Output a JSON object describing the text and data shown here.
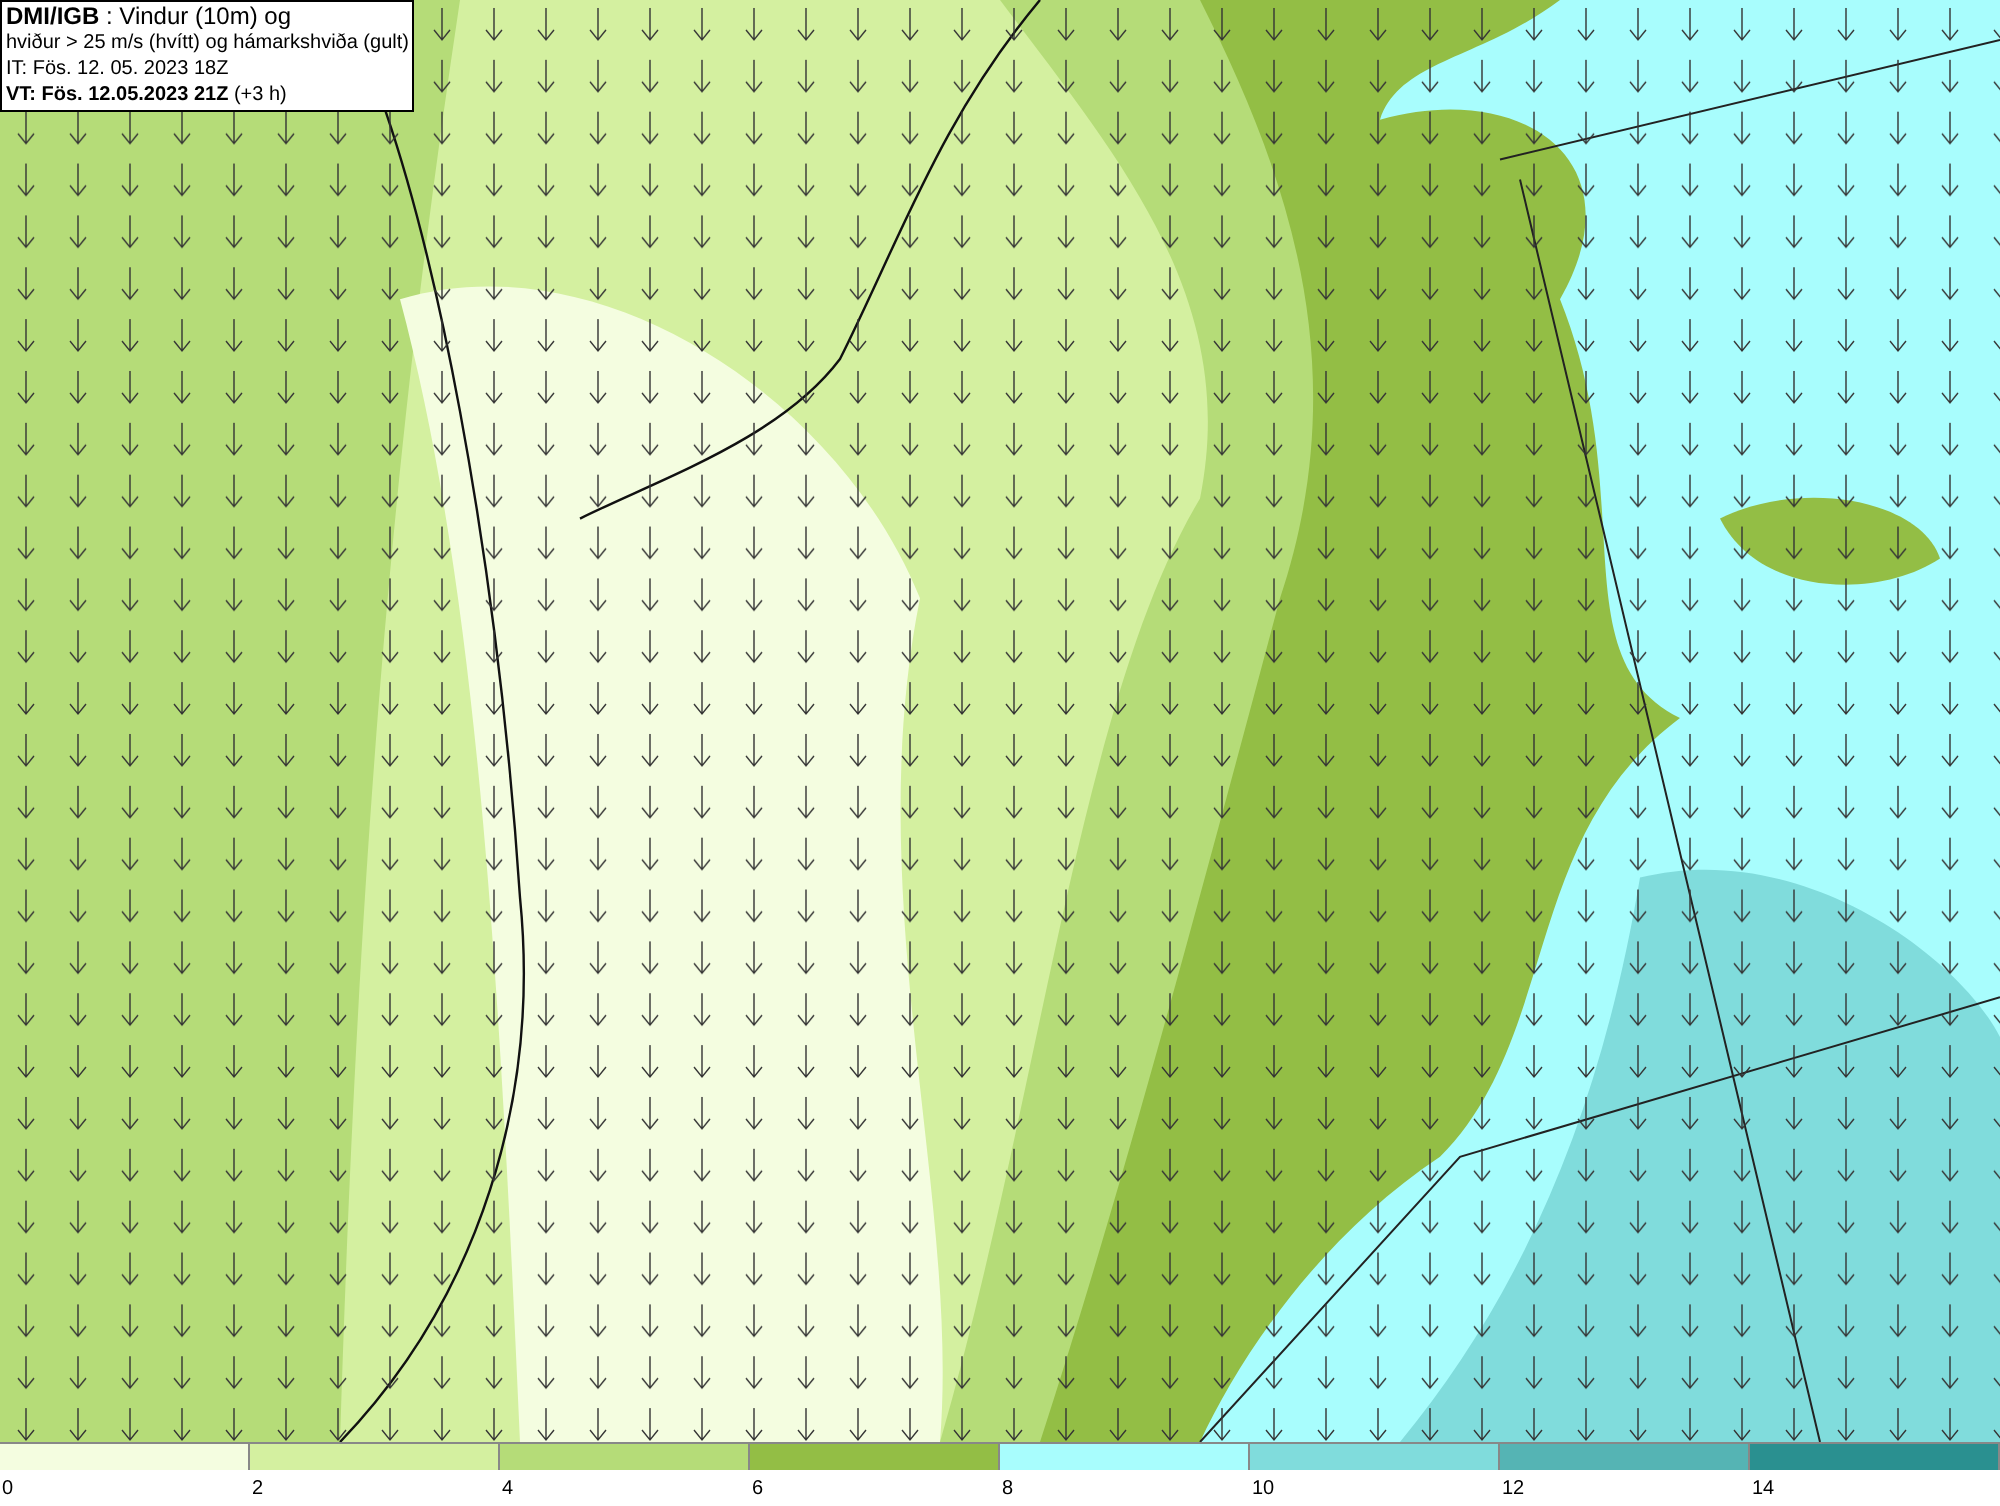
{
  "header": {
    "lines": [
      "**DMI/IGB** : Vindur (10m) og",
      "hviður > 25 m/s (hvítt) og hámarkshviða (gult)",
      "IT: Fös. 12. 05. 2023 18Z",
      "**VT: Fös. 12.05.2023 21Z** (+3 h)"
    ]
  },
  "legend": {
    "bins": [
      {
        "color": "#f4fde0"
      },
      {
        "color": "#d4f0a0"
      },
      {
        "color": "#b5dc78"
      },
      {
        "color": "#93be45"
      },
      {
        "color": "#a8fdfd"
      },
      {
        "color": "#80dcdc"
      },
      {
        "color": "#55b4b4"
      },
      {
        "color": "#2a9090"
      }
    ],
    "ticks": [
      "0",
      "2",
      "4",
      "6",
      "8",
      "10",
      "12",
      "14"
    ]
  }
}
